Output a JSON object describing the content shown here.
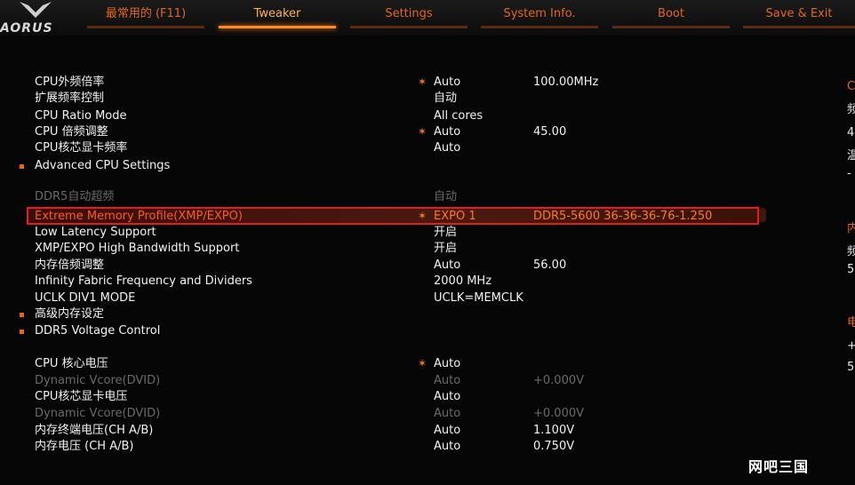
{
  "brand": {
    "logo_text": "AORUS"
  },
  "tabs": [
    {
      "label": "最常用的 (F11)",
      "active": false
    },
    {
      "label": "Tweaker",
      "active": true
    },
    {
      "label": "Settings",
      "active": false
    },
    {
      "label": "System Info.",
      "active": false
    },
    {
      "label": "Boot",
      "active": false
    },
    {
      "label": "Save & Exit",
      "active": false
    }
  ],
  "rows": [
    {
      "label": "CPU外频倍率",
      "value": "Auto",
      "value2": "100.00MHz",
      "star": true
    },
    {
      "label": "扩展频率控制",
      "value": "自动"
    },
    {
      "label": "CPU Ratio Mode",
      "value": "All cores"
    },
    {
      "label": "CPU 倍频调整",
      "value": "Auto",
      "value2": "45.00",
      "star": true
    },
    {
      "label": "CPU核芯显卡频率",
      "value": "Auto"
    },
    {
      "label": "Advanced CPU Settings",
      "submenu": true
    },
    {
      "label": "DDR5自动超频",
      "value": "自动",
      "dim": true
    },
    {
      "label": "Extreme Memory Profile(XMP/EXPO)",
      "value": "EXPO 1",
      "value2": "DDR5-5600 36-36-36-76-1.250",
      "star": true,
      "selected": true
    },
    {
      "label": "Low Latency Support",
      "value": "开启"
    },
    {
      "label": "XMP/EXPO High Bandwidth Support",
      "value": "开启"
    },
    {
      "label": "内存倍频调整",
      "value": "Auto",
      "value2": "56.00"
    },
    {
      "label": "Infinity Fabric Frequency and Dividers",
      "value": "2000 MHz"
    },
    {
      "label": "UCLK DIV1 MODE",
      "value": "UCLK=MEMCLK"
    },
    {
      "label": "高级内存设定",
      "submenu": true
    },
    {
      "label": "DDR5 Voltage Control",
      "submenu": true
    },
    {
      "label": "CPU 核心电压",
      "value": "Auto",
      "star": true
    },
    {
      "label": "Dynamic Vcore(DVID)",
      "value": "Auto",
      "value2": "+0.000V",
      "dim": true
    },
    {
      "label": "CPU核芯显卡电压",
      "value": "Auto"
    },
    {
      "label": "Dynamic Vcore(DVID)",
      "value": "Auto",
      "value2": "+0.000V",
      "dim": true
    },
    {
      "label": "内存终端电压(CH A/B)",
      "value": "Auto",
      "value2": "1.100V"
    },
    {
      "label": "内存电压        (CH A/B)",
      "value": "Auto",
      "value2": "0.750V"
    }
  ],
  "right_panel": [
    "C",
    "频",
    "4",
    "温",
    "-",
    "内",
    "频",
    "5",
    "电",
    "+",
    "5"
  ],
  "watermark": "网吧三国",
  "colors": {
    "accent": "#e2671a",
    "active_tab": "#ff8c2a",
    "selection_border": "#e02020",
    "dim_text": "#6a6a6a"
  }
}
